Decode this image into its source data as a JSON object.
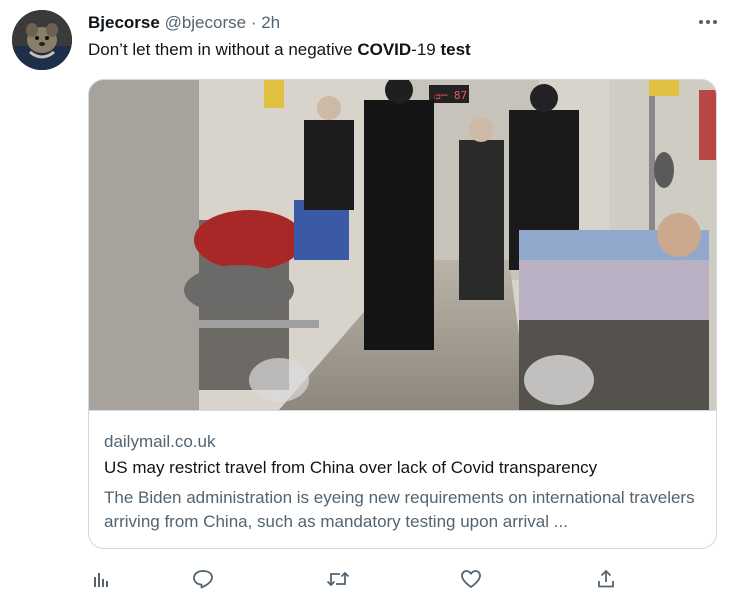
{
  "tweet": {
    "display_name": "Bjecorse",
    "handle": "@bjecorse",
    "separator": "·",
    "time": "2h",
    "text_parts": [
      "Don’t let them in without a negative ",
      "COVID",
      "-19 ",
      "test"
    ]
  },
  "card": {
    "domain": "dailymail.co.uk",
    "title": "US may restrict travel from China over lack of Covid transparency",
    "description": "The Biden administration is eyeing new requirements on international travelers arriving from China, such as mandatory testing upon arrival ...",
    "image_sign": "ᴞ─ 87"
  },
  "icons": {
    "more": "more-horizontal-icon",
    "analytics": "analytics-icon",
    "reply": "reply-icon",
    "retweet": "retweet-icon",
    "like": "like-icon",
    "share": "share-icon"
  },
  "colors": {
    "text": "#0f1419",
    "secondary": "#536471",
    "border": "#cfd9de"
  }
}
